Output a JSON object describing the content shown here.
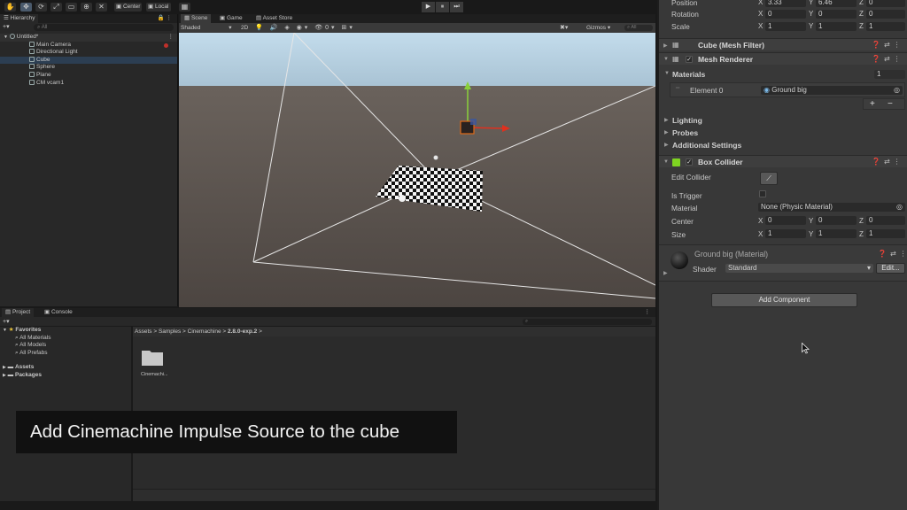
{
  "toolbar": {
    "pivot_label": "Center",
    "space_label": "Local",
    "play_icon": "▶",
    "pause_icon": "⏸",
    "step_icon": "⏭"
  },
  "hierarchy": {
    "tab_label": "Hierarchy",
    "search_placeholder": "All",
    "add_label": "+▾",
    "scene_name": "Untitled*",
    "items": [
      {
        "label": "Main Camera"
      },
      {
        "label": "Directional Light"
      },
      {
        "label": "Cube"
      },
      {
        "label": "Sphere"
      },
      {
        "label": "Plane"
      },
      {
        "label": "CM vcam1"
      }
    ]
  },
  "scene": {
    "tabs": [
      "Scene",
      "Game",
      "Asset Store"
    ],
    "shading_mode": "Shaded",
    "mode_2d": "2D",
    "gizmos_label": "Gizmos",
    "search_placeholder": "All"
  },
  "project": {
    "tabs": [
      "Project",
      "Console"
    ],
    "add_label": "+▾",
    "favorites_label": "Favorites",
    "favorites": [
      "All Materials",
      "All Models",
      "All Prefabs"
    ],
    "roots": [
      "Assets",
      "Packages"
    ],
    "breadcrumb": [
      "Assets",
      "Samples",
      "Cinemachine",
      "2.8.0-exp.2"
    ],
    "folder_label": "Cinemachi..."
  },
  "caption": {
    "text": "Add Cinemachine Impulse Source to the cube"
  },
  "inspector": {
    "transform": {
      "position_label": "Position",
      "rotation_label": "Rotation",
      "scale_label": "Scale",
      "position": {
        "x": "3.33",
        "y": "6.46",
        "z": "0"
      },
      "rotation": {
        "x": "0",
        "y": "0",
        "z": "0"
      },
      "scale": {
        "x": "1",
        "y": "1",
        "z": "1"
      }
    },
    "mesh_filter": {
      "title": "Cube (Mesh Filter)"
    },
    "mesh_renderer": {
      "title": "Mesh Renderer",
      "materials_label": "Materials",
      "materials_count": "1",
      "element_label": "Element 0",
      "element_value": "Ground big",
      "lighting_label": "Lighting",
      "probes_label": "Probes",
      "additional_label": "Additional Settings"
    },
    "box_collider": {
      "title": "Box Collider",
      "edit_label": "Edit Collider",
      "trigger_label": "Is Trigger",
      "material_label": "Material",
      "material_value": "None (Physic Material)",
      "center_label": "Center",
      "size_label": "Size",
      "center": {
        "x": "0",
        "y": "0",
        "z": "0"
      },
      "size": {
        "x": "1",
        "y": "1",
        "z": "1"
      }
    },
    "material": {
      "title": "Ground big (Material)",
      "shader_label": "Shader",
      "shader_value": "Standard",
      "edit_label": "Edit..."
    },
    "add_component_label": "Add Component",
    "axis": {
      "x": "X",
      "y": "Y",
      "z": "Z"
    }
  },
  "colors": {
    "panel": "#383838",
    "selection": "#2c3e52",
    "caption_bg": "#111111",
    "sky": "#b4d0e4",
    "ground": "#5e5650"
  }
}
